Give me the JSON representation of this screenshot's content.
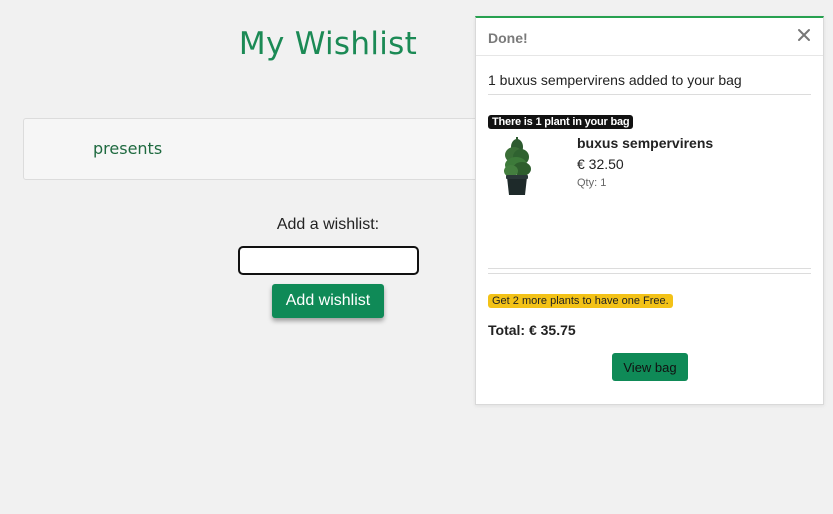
{
  "page": {
    "title": "My Wishlist"
  },
  "wishlists": [
    {
      "name": "presents"
    }
  ],
  "add_form": {
    "label": "Add a wishlist:",
    "input_value": "",
    "button_label": "Add wishlist"
  },
  "toast": {
    "title": "Done!",
    "message": "1 buxus sempervirens added to your bag",
    "bag_count_badge": "There is 1 plant in your bag",
    "product": {
      "name": "buxus sempervirens",
      "price": "€ 32.50",
      "qty": "Qty: 1",
      "image_icon": "potted-plant-icon"
    },
    "promo_badge": "Get 2 more plants to have one Free.",
    "total": "Total: € 35.75",
    "view_bag_label": "View bag",
    "close_icon": "close-icon"
  },
  "colors": {
    "accent_green": "#0f8a57",
    "title_green": "#1b8a55",
    "toast_border_green": "#27a150",
    "promo_yellow": "#f3c217",
    "background": "#f1f1f1"
  }
}
